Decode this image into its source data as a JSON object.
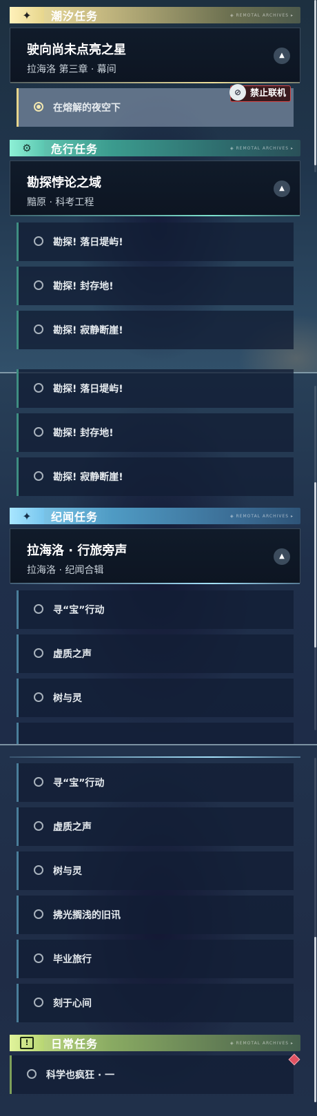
{
  "categories": {
    "tide": {
      "label": "潮汐任务",
      "icon": "sparkle-icon",
      "color": "#f3e5a5"
    },
    "danger": {
      "label": "危行任务",
      "icon": "gear-icon",
      "color": "#71d6bf"
    },
    "chron": {
      "label": "纪闻任务",
      "icon": "sparkle-icon",
      "color": "#8fd6f6"
    },
    "daily": {
      "label": "日常任务",
      "icon": "alert-icon",
      "color": "#cfe88a"
    }
  },
  "deco_text": "◈ REMOTAL ARCHIVES ▸",
  "tide_quest": {
    "title": "驶向尚未点亮之星",
    "subtitle": "拉海洛 第三章 · 幕间"
  },
  "tide_step": {
    "label": "在熔解的夜空下",
    "status": "active"
  },
  "lock_badge": {
    "label": "禁止联机",
    "icon": "lock-icon"
  },
  "danger_quest": {
    "title": "勘探悖论之域",
    "subtitle": "黯原 · 科考工程"
  },
  "danger_steps": [
    "勘探! 落日堤屿!",
    "勘探! 封存地!",
    "勘探! 寂静断崖!"
  ],
  "chron_quest": {
    "title": "拉海洛 · 行旅旁声",
    "subtitle": "拉海洛 · 纪闻合辑"
  },
  "chron_steps_a": [
    "寻“宝”行动",
    "虚质之声",
    "树与灵"
  ],
  "chron_steps_b": [
    "寻“宝”行动",
    "虚质之声",
    "树与灵",
    "拂光搁浅的旧讯",
    "毕业旅行",
    "刻于心间"
  ],
  "daily_steps": [
    "科学也疯狂 · 一"
  ],
  "collapse_icon": "chevron-up-icon",
  "daily_marker_icon": "diamond-icon"
}
